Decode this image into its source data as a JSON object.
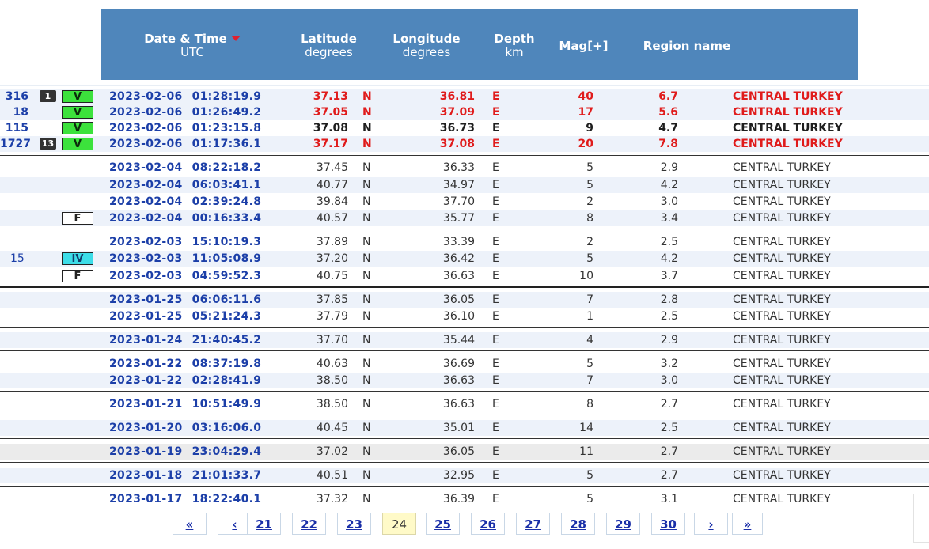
{
  "header": {
    "date": "Date & Time",
    "date_sub": "UTC",
    "lat": "Latitude",
    "lat_sub": "degrees",
    "lon": "Longitude",
    "lon_sub": "degrees",
    "depth": "Depth",
    "depth_sub": "km",
    "mag": "Mag[+]",
    "region": "Region name",
    "color": "#4f86bb"
  },
  "rows": [
    {
      "count": "316",
      "icon": "1",
      "intensity": "V",
      "date": "2023-02-06",
      "time": "01:28:19.9",
      "lat": "37.13",
      "ns": "N",
      "lon": "36.81",
      "ew": "E",
      "depth": "40",
      "mag": "6.7",
      "region": "CENTRAL TURKEY"
    },
    {
      "count": "18",
      "icon": "",
      "intensity": "V",
      "date": "2023-02-06",
      "time": "01:26:49.2",
      "lat": "37.05",
      "ns": "N",
      "lon": "37.09",
      "ew": "E",
      "depth": "17",
      "mag": "5.6",
      "region": "CENTRAL TURKEY"
    },
    {
      "count": "115",
      "icon": "",
      "intensity": "V",
      "date": "2023-02-06",
      "time": "01:23:15.8",
      "lat": "37.08",
      "ns": "N",
      "lon": "36.73",
      "ew": "E",
      "depth": "9",
      "mag": "4.7",
      "region": "CENTRAL TURKEY"
    },
    {
      "count": "1727",
      "icon": "13",
      "intensity": "V",
      "date": "2023-02-06",
      "time": "01:17:36.1",
      "lat": "37.17",
      "ns": "N",
      "lon": "37.08",
      "ew": "E",
      "depth": "20",
      "mag": "7.8",
      "region": "CENTRAL TURKEY"
    },
    {
      "count": "",
      "icon": "",
      "intensity": "",
      "date": "2023-02-04",
      "time": "08:22:18.2",
      "lat": "37.45",
      "ns": "N",
      "lon": "36.33",
      "ew": "E",
      "depth": "5",
      "mag": "2.9",
      "region": "CENTRAL TURKEY"
    },
    {
      "count": "",
      "icon": "",
      "intensity": "",
      "date": "2023-02-04",
      "time": "06:03:41.1",
      "lat": "40.77",
      "ns": "N",
      "lon": "34.97",
      "ew": "E",
      "depth": "5",
      "mag": "4.2",
      "region": "CENTRAL TURKEY"
    },
    {
      "count": "",
      "icon": "",
      "intensity": "",
      "date": "2023-02-04",
      "time": "02:39:24.8",
      "lat": "39.84",
      "ns": "N",
      "lon": "37.70",
      "ew": "E",
      "depth": "2",
      "mag": "3.0",
      "region": "CENTRAL TURKEY"
    },
    {
      "count": "",
      "icon": "",
      "intensity": "F",
      "date": "2023-02-04",
      "time": "00:16:33.4",
      "lat": "40.57",
      "ns": "N",
      "lon": "35.77",
      "ew": "E",
      "depth": "8",
      "mag": "3.4",
      "region": "CENTRAL TURKEY"
    },
    {
      "count": "",
      "icon": "",
      "intensity": "",
      "date": "2023-02-03",
      "time": "15:10:19.3",
      "lat": "37.89",
      "ns": "N",
      "lon": "33.39",
      "ew": "E",
      "depth": "2",
      "mag": "2.5",
      "region": "CENTRAL TURKEY"
    },
    {
      "count": "15",
      "icon": "",
      "intensity": "IV",
      "date": "2023-02-03",
      "time": "11:05:08.9",
      "lat": "37.20",
      "ns": "N",
      "lon": "36.42",
      "ew": "E",
      "depth": "5",
      "mag": "4.2",
      "region": "CENTRAL TURKEY"
    },
    {
      "count": "",
      "icon": "",
      "intensity": "F",
      "date": "2023-02-03",
      "time": "04:59:52.3",
      "lat": "40.75",
      "ns": "N",
      "lon": "36.63",
      "ew": "E",
      "depth": "10",
      "mag": "3.7",
      "region": "CENTRAL TURKEY"
    },
    {
      "count": "",
      "icon": "",
      "intensity": "",
      "date": "2023-01-25",
      "time": "06:06:11.6",
      "lat": "37.85",
      "ns": "N",
      "lon": "36.05",
      "ew": "E",
      "depth": "7",
      "mag": "2.8",
      "region": "CENTRAL TURKEY"
    },
    {
      "count": "",
      "icon": "",
      "intensity": "",
      "date": "2023-01-25",
      "time": "05:21:24.3",
      "lat": "37.79",
      "ns": "N",
      "lon": "36.10",
      "ew": "E",
      "depth": "1",
      "mag": "2.5",
      "region": "CENTRAL TURKEY"
    },
    {
      "count": "",
      "icon": "",
      "intensity": "",
      "date": "2023-01-24",
      "time": "21:40:45.2",
      "lat": "37.70",
      "ns": "N",
      "lon": "35.44",
      "ew": "E",
      "depth": "4",
      "mag": "2.9",
      "region": "CENTRAL TURKEY"
    },
    {
      "count": "",
      "icon": "",
      "intensity": "",
      "date": "2023-01-22",
      "time": "08:37:19.8",
      "lat": "40.63",
      "ns": "N",
      "lon": "36.69",
      "ew": "E",
      "depth": "5",
      "mag": "3.2",
      "region": "CENTRAL TURKEY"
    },
    {
      "count": "",
      "icon": "",
      "intensity": "",
      "date": "2023-01-22",
      "time": "02:28:41.9",
      "lat": "38.50",
      "ns": "N",
      "lon": "36.63",
      "ew": "E",
      "depth": "7",
      "mag": "3.0",
      "region": "CENTRAL TURKEY"
    },
    {
      "count": "",
      "icon": "",
      "intensity": "",
      "date": "2023-01-21",
      "time": "10:51:49.9",
      "lat": "38.50",
      "ns": "N",
      "lon": "36.63",
      "ew": "E",
      "depth": "8",
      "mag": "2.7",
      "region": "CENTRAL TURKEY"
    },
    {
      "count": "",
      "icon": "",
      "intensity": "",
      "date": "2023-01-20",
      "time": "03:16:06.0",
      "lat": "40.45",
      "ns": "N",
      "lon": "35.01",
      "ew": "E",
      "depth": "14",
      "mag": "2.5",
      "region": "CENTRAL TURKEY"
    },
    {
      "count": "",
      "icon": "",
      "intensity": "",
      "date": "2023-01-19",
      "time": "23:04:29.4",
      "lat": "37.02",
      "ns": "N",
      "lon": "36.05",
      "ew": "E",
      "depth": "11",
      "mag": "2.7",
      "region": "CENTRAL TURKEY"
    },
    {
      "count": "",
      "icon": "",
      "intensity": "",
      "date": "2023-01-18",
      "time": "21:01:33.7",
      "lat": "40.51",
      "ns": "N",
      "lon": "32.95",
      "ew": "E",
      "depth": "5",
      "mag": "2.7",
      "region": "CENTRAL TURKEY"
    },
    {
      "count": "",
      "icon": "",
      "intensity": "",
      "date": "2023-01-17",
      "time": "18:22:40.1",
      "lat": "37.32",
      "ns": "N",
      "lon": "36.39",
      "ew": "E",
      "depth": "5",
      "mag": "3.1",
      "region": "CENTRAL TURKEY"
    }
  ],
  "pagination": {
    "first": "«",
    "prev": "‹",
    "pages": [
      "21",
      "22",
      "23",
      "24",
      "25",
      "26",
      "27",
      "28",
      "29",
      "30"
    ],
    "current": "24",
    "next": "›",
    "last": "»"
  },
  "colors": {
    "major_quake": "#e01b1b",
    "link_blue": "#1c3fa8",
    "intensity_V": "#3ce23c",
    "intensity_IV": "#3cdde8",
    "current_page": "#fffac8"
  }
}
